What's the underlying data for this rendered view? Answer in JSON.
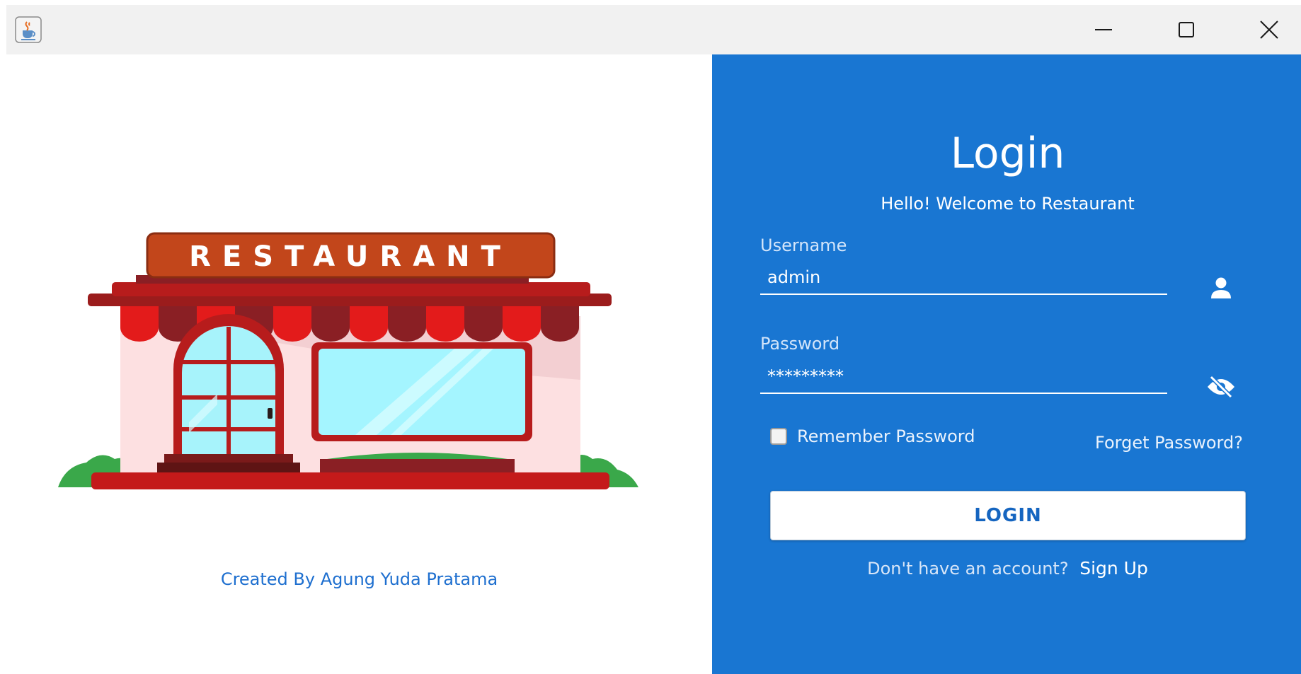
{
  "titlebar": {
    "app_icon": "java-coffee-icon",
    "minimize_icon": "minimize-icon",
    "maximize_icon": "maximize-icon",
    "close_icon": "close-icon"
  },
  "left": {
    "sign_text": "RESTAURANT",
    "credit": "Created By Agung Yuda Pratama"
  },
  "login": {
    "title": "Login",
    "subtitle": "Hello! Welcome to Restaurant",
    "username_label": "Username",
    "username_value": "admin",
    "password_label": "Password",
    "password_value": "*********",
    "user_icon": "user-icon",
    "eye_icon": "eye-off-icon",
    "remember_label": "Remember Password",
    "remember_checked": false,
    "forget_label": "Forget Password?",
    "login_button": "LOGIN",
    "signup_prompt": "Don't have an account?",
    "signup_link": "Sign Up"
  },
  "colors": {
    "panel_blue": "#1976d2",
    "credit_blue": "#1e6fcf",
    "button_text": "#1565c0"
  }
}
